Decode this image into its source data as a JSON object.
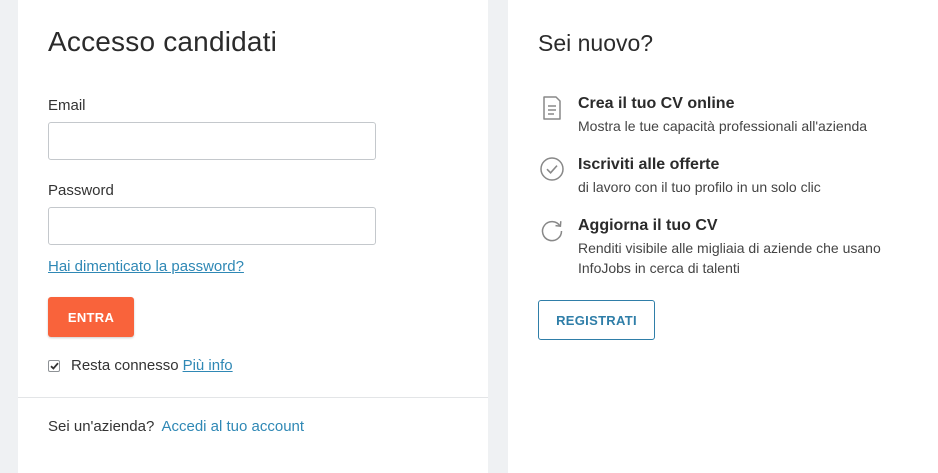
{
  "login": {
    "title": "Accesso candidati",
    "email_label": "Email",
    "email_value": "",
    "password_label": "Password",
    "password_value": "",
    "forgot_password": "Hai dimenticato la password?",
    "submit_label": "ENTRA",
    "remember_label": "Resta connesso",
    "remember_checked": true,
    "more_info_link": "Più info",
    "company_prompt": "Sei un'azienda?",
    "company_link": "Accedi al tuo account"
  },
  "register": {
    "title": "Sei nuovo?",
    "benefits": [
      {
        "icon": "document-icon",
        "title": "Crea il tuo CV online",
        "description": "Mostra le tue capacità professionali all'azienda"
      },
      {
        "icon": "check-circle-icon",
        "title": "Iscriviti alle offerte",
        "description": "di lavoro con il tuo profilo in un solo clic"
      },
      {
        "icon": "refresh-icon",
        "title": "Aggiorna il tuo CV",
        "description": "Renditi visibile alle migliaia di aziende che usano InfoJobs in cerca di talenti"
      }
    ],
    "button_label": "REGISTRATI"
  },
  "colors": {
    "primary_button": "#f9633b",
    "link": "#2f88b5",
    "secondary_button_border": "#2f7ea8",
    "background": "#eff1f3",
    "panel": "#ffffff"
  }
}
